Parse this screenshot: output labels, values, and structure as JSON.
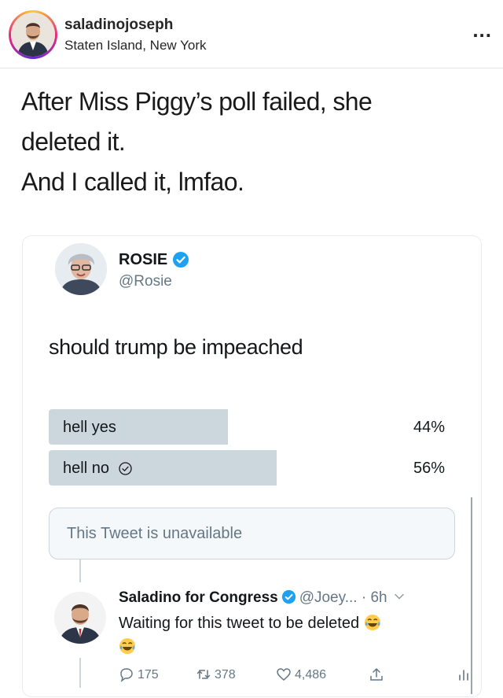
{
  "post": {
    "username": "saladinojoseph",
    "location": "Staten Island, New York",
    "more_icon": "more-options-icon",
    "more_label": "..."
  },
  "caption": {
    "lines": [
      "After Miss Piggy’s poll failed, she",
      "deleted it.",
      "And I called it, lmfao."
    ]
  },
  "tweet": {
    "author_name": "ROSIE",
    "author_handle": "@Rosie",
    "text": "should trump be impeached",
    "poll": [
      {
        "label": "hell yes",
        "percent_text": "44%",
        "fraction": 0.44,
        "selected": false
      },
      {
        "label": "hell no",
        "percent_text": "56%",
        "fraction": 0.56,
        "selected": true
      }
    ],
    "unavailable_text": "This Tweet is unavailable"
  },
  "reply": {
    "name": "Saladino for Congress",
    "handle": "@Joey...",
    "separator": "·",
    "time": "6h",
    "text": "Waiting for this tweet to be deleted",
    "counts": {
      "replies": "175",
      "retweets": "378",
      "likes": "4,486"
    }
  },
  "colors": {
    "verified": "#1da1f2",
    "poll_bar": "#ccd6dd",
    "muted_text": "#657786"
  }
}
